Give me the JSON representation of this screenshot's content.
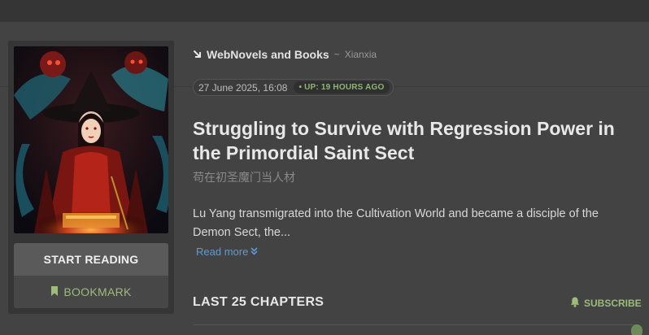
{
  "breadcrumb": {
    "arrow_icon": "arrow-down-right-icon",
    "site": "WebNovels and Books",
    "separator": "~",
    "genre": "Xianxia"
  },
  "dates": {
    "published": "27 June 2025, 16:08",
    "updated": "• UP: 19 HOURS AGO"
  },
  "novel": {
    "title": "Struggling to Survive with Regression Power in the Primordial Saint Sect",
    "alt_title": "苟在初圣魔门当人材",
    "description": "Lu Yang transmigrated into the Cultivation World and became a disciple of the Demon Sect, the...",
    "read_more": "Read more"
  },
  "actions": {
    "start_reading": "START READING",
    "bookmark": "BOOKMARK",
    "bookmark_icon": "bookmark-icon"
  },
  "chapters": {
    "section_title": "LAST 25 CHAPTERS",
    "subscribe": "SUBSCRIBE",
    "subscribe_icon": "bell-icon"
  },
  "colors": {
    "background": "#434343",
    "accent_green": "#9dbb7a",
    "link_blue": "#5b9bd6"
  }
}
